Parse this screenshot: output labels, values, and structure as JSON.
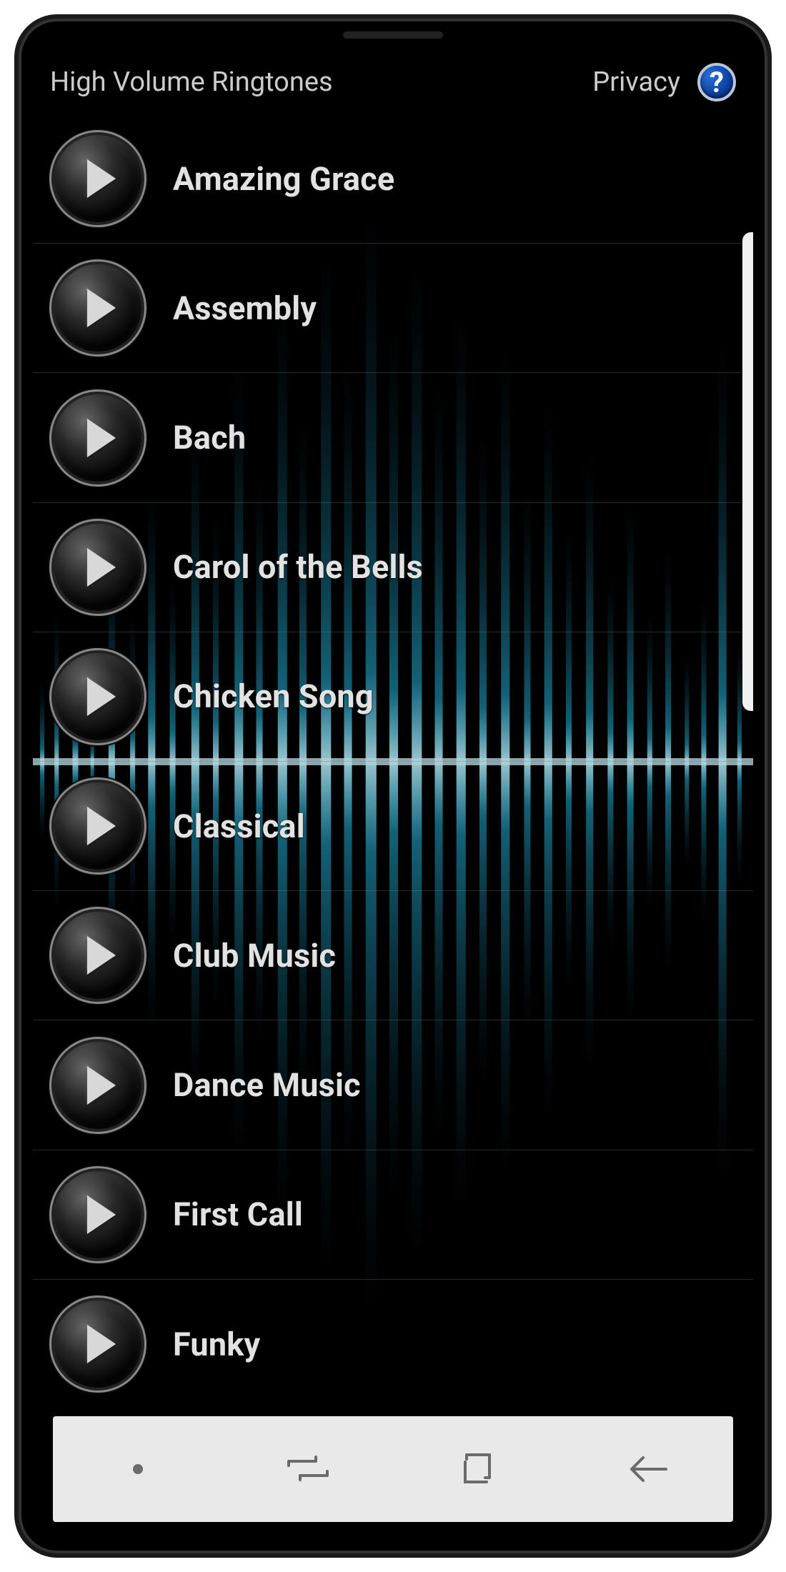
{
  "header": {
    "title": "High Volume Ringtones",
    "privacy_label": "Privacy",
    "help_symbol": "?"
  },
  "ringtones": [
    {
      "name": "Amazing Grace"
    },
    {
      "name": "Assembly"
    },
    {
      "name": "Bach"
    },
    {
      "name": "Carol of the Bells"
    },
    {
      "name": "Chicken Song"
    },
    {
      "name": "Classical"
    },
    {
      "name": "Club Music"
    },
    {
      "name": "Dance Music"
    },
    {
      "name": "First Call"
    },
    {
      "name": "Funky"
    }
  ],
  "colors": {
    "accent": "#3fd7ff",
    "help_button": "#0d4bb5"
  }
}
